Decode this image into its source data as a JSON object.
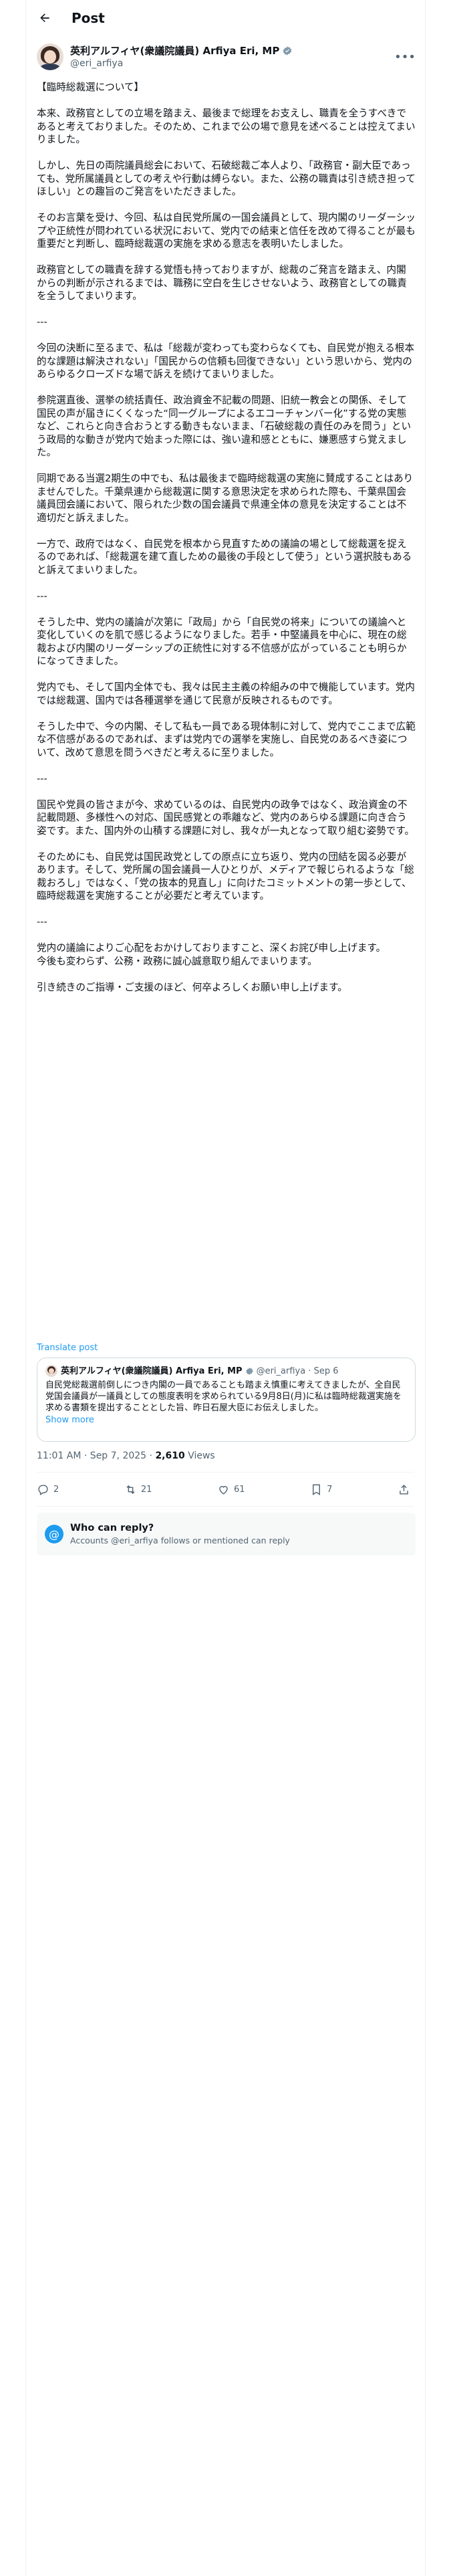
{
  "header": {
    "title": "Post"
  },
  "author": {
    "name": "英利アルフィヤ(衆議院議員) Arfiya Eri, MP",
    "handle": "@eri_arfiya"
  },
  "post": {
    "text": "【臨時総裁選について】\n\n本来、政務官としての立場を踏まえ、最後まで総理をお支えし、職責を全うすべきであると考えておりました。そのため、これまで公の場で意見を述べることは控えてまいりました。\n\nしかし、先日の両院議員総会において、石破総裁ご本人より、「政務官・副大臣であっても、党所属議員としての考えや行動は縛らない。また、公務の職責は引き続き担ってほしい」との趣旨のご発言をいただきました。\n\nそのお言葉を受け、今回、私は自民党所属の一国会議員として、現内閣のリーダーシップや正統性が問われている状況において、党内での結束と信任を改めて得ることが最も重要だと判断し、臨時総裁選の実施を求める意志を表明いたしました。\n\n政務官としての職責を辞する覚悟も持っておりますが、総裁のご発言を踏まえ、内閣からの判断が示されるまでは、職務に空白を生じさせないよう、政務官としての職責を全うしてまいります。\n\n---\n\n今回の決断に至るまで、私は「総裁が変わっても変わらなくても、自民党が抱える根本的な課題は解決されない」「国民からの信頼も回復できない」という思いから、党内のあらゆるクローズドな場で訴えを続けてまいりました。\n\n参院選直後、選挙の統括責任、政治資金不記載の問題、旧統一教会との関係、そして国民の声が届きにくくなった“同一グループによるエコーチャンバー化”する党の実態など、これらと向き合おうとする動きもないまま、「石破総裁の責任のみを問う」という政局的な動きが党内で始まった際には、強い違和感とともに、嫌悪感すら覚えました。\n\n同期である当選2期生の中でも、私は最後まで臨時総裁選の実施に賛成することはありませんでした。千葉県連から総裁選に関する意思決定を求められた際も、千葉県国会議員団会議において、限られた少数の国会議員で県連全体の意見を決定することは不適切だと訴えました。\n\n一方で、政府ではなく、自民党を根本から見直すための議論の場として総裁選を捉えるのであれば、「総裁選を建て直しための最後の手段として使う」という選択肢もあると訴えてまいりました。\n\n---\n\nそうした中、党内の議論が次第に「政局」から「自民党の将来」についての議論へと変化していくのを肌で感じるようになりました。若手・中堅議員を中心に、現在の総裁および内閣のリーダーシップの正統性に対する不信感が広がっていることも明らかになってきました。\n\n党内でも、そして国内全体でも、我々は民主主義の枠組みの中で機能しています。党内では総裁選、国内では各種選挙を通じて民意が反映されるものです。\n\nそうした中で、今の内閣、そして私も一員である現体制に対して、党内でここまで広範な不信感があるのであれば、まずは党内での選挙を実施し、自民党のあるべき姿について、改めて意思を問うべきだと考えるに至りました。\n\n---\n\n国民や党員の皆さまが今、求めているのは、自民党内の政争ではなく、政治資金の不記載問題、多様性への対応、国民感覚との乖離など、党内のあらゆる課題に向き合う姿です。また、国内外の山積する課題に対し、我々が一丸となって取り組む姿勢です。\n\nそのためにも、自民党は国民政党としての原点に立ち返り、党内の団結を図る必要があります。そして、党所属の国会議員一人ひとりが、メディアで報じられるような「総裁おろし」ではなく、「党の抜本的見直し」に向けたコミットメントの第一歩として、臨時総裁選を実施することが必要だと考えています。\n\n---\n\n党内の議論によりご心配をおかけしておりますこと、深くお詫び申し上げます。\n今後も変わらず、公務・政務に誠心誠意取り組んでまいります。\n\n引き続きのご指導・ご支援のほど、何卒よろしくお願い申し上げます。",
    "translate_label": "Translate post",
    "timestamp": "11:01 AM · Sep 7, 2025 ·",
    "views_count": "2,610",
    "views_label": "Views"
  },
  "quote": {
    "name": "英利アルフィヤ(衆議院議員) Arfiya Eri, MP",
    "handle_date": "@eri_arfiya · Sep 6",
    "text": "自民党総裁選前倒しにつき内閣の一員であることも踏まえ慎重に考えてきましたが、全自民党国会議員が一議員としての態度表明を求められている9月8日(月)に私は臨時総裁選実施を求める書類を提出することとした旨、昨日石屋大臣にお伝えしました。",
    "show_more": "Show more"
  },
  "actions": {
    "replies": "2",
    "reposts": "21",
    "likes": "61",
    "bookmarks": "7"
  },
  "reply_notice": {
    "title": "Who can reply?",
    "subtitle": "Accounts @eri_arfiya follows or mentioned can reply"
  },
  "colors": {
    "accent": "#1d9bf0",
    "text": "#0f1419",
    "muted": "#536471",
    "border": "#cfd9de"
  }
}
